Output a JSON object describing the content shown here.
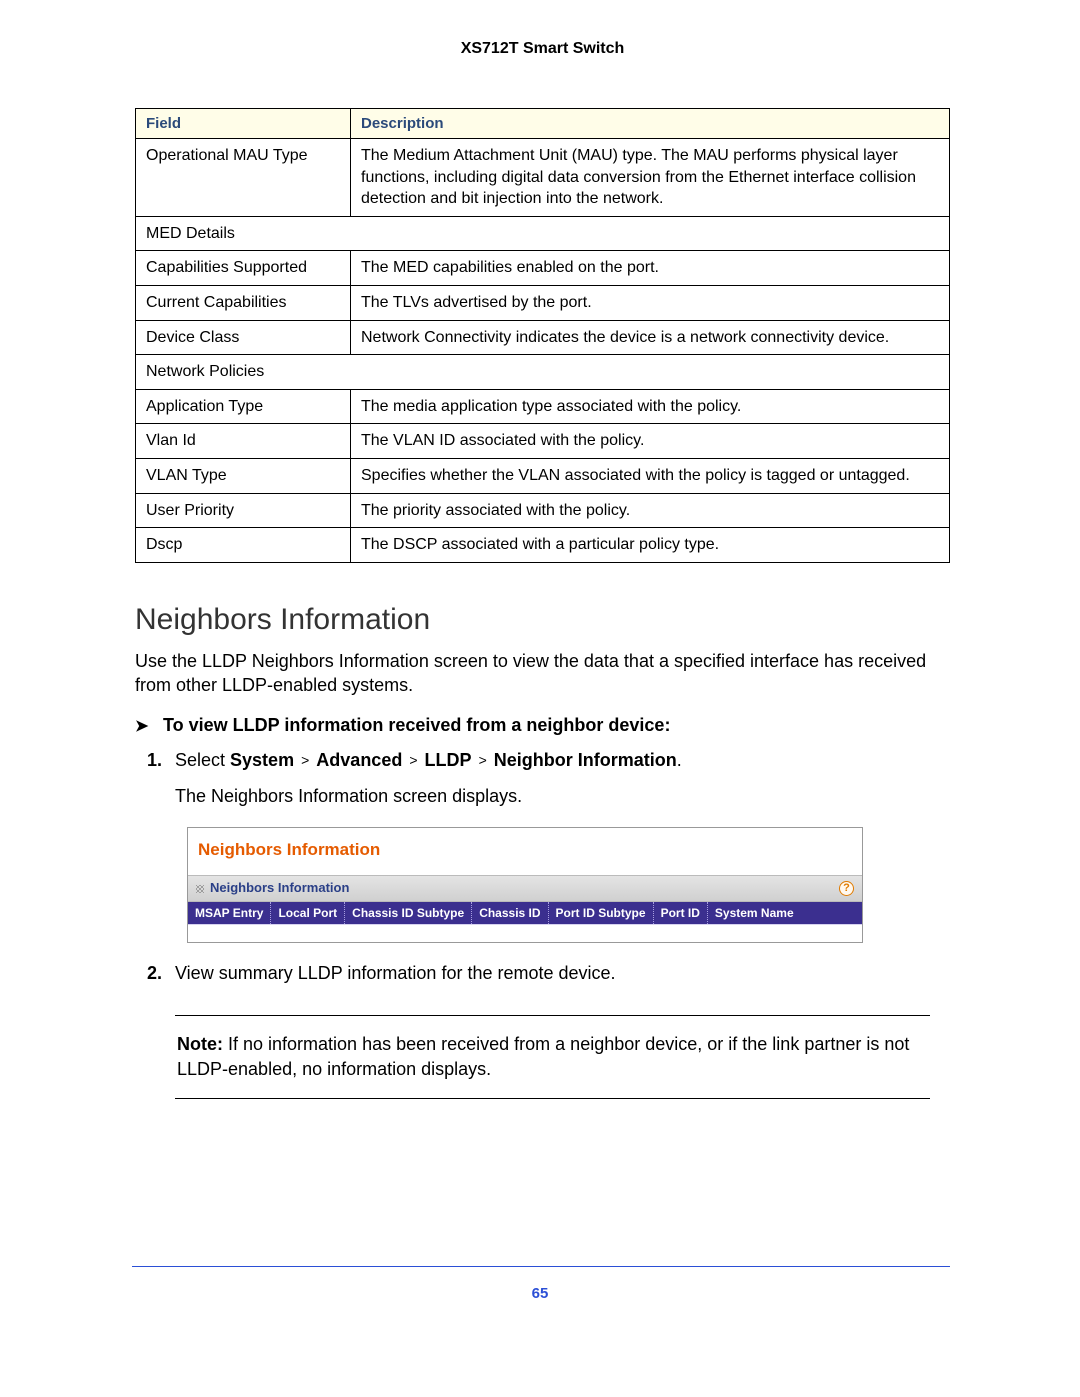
{
  "header": {
    "product": "XS712T Smart Switch"
  },
  "table": {
    "headers": {
      "field": "Field",
      "desc": "Description"
    },
    "rows": [
      {
        "type": "pair",
        "field": "Operational MAU Type",
        "desc": "The Medium Attachment Unit (MAU) type. The MAU performs physical layer functions, including digital data conversion from the Ethernet interface collision detection and bit injection into the network."
      },
      {
        "type": "span",
        "field": "MED Details"
      },
      {
        "type": "pair",
        "field": "Capabilities Supported",
        "desc": "The MED capabilities enabled on the port."
      },
      {
        "type": "pair",
        "field": "Current Capabilities",
        "desc": "The TLVs advertised by the port."
      },
      {
        "type": "pair",
        "field": "Device Class",
        "desc": "Network Connectivity indicates the device is a network connectivity device."
      },
      {
        "type": "span",
        "field": "Network Policies"
      },
      {
        "type": "pair",
        "field": "Application Type",
        "desc": "The media application type associated with the policy."
      },
      {
        "type": "pair",
        "field": "Vlan Id",
        "desc": "The VLAN ID associated with the policy."
      },
      {
        "type": "pair",
        "field": "VLAN Type",
        "desc": "Specifies whether the VLAN associated with the policy is tagged or untagged."
      },
      {
        "type": "pair",
        "field": "User Priority",
        "desc": "The priority associated with the policy."
      },
      {
        "type": "pair",
        "field": "Dscp",
        "desc": "The DSCP associated with a particular policy type."
      }
    ]
  },
  "section": {
    "heading": "Neighbors Information",
    "intro": "Use the LLDP Neighbors Information screen to view the data that a specified interface has received from other LLDP-enabled systems.",
    "procedure_title": "To view LLDP information received from a neighbor device:",
    "step1_prefix": "Select ",
    "nav": {
      "p1": "System",
      "p2": "Advanced",
      "p3": "LLDP",
      "p4": "Neighbor Information",
      "sep": ">"
    },
    "nav_suffix": ".",
    "step1_sub": "The Neighbors Information screen displays.",
    "step2": "View summary LLDP information for the remote device."
  },
  "ui": {
    "title": "Neighbors Information",
    "subtitle": "Neighbors Information",
    "help": "?",
    "cols": [
      "MSAP Entry",
      "Local Port",
      "Chassis ID Subtype",
      "Chassis ID",
      "Port ID Subtype",
      "Port ID",
      "System Name"
    ]
  },
  "note": {
    "label": "Note:",
    "text": " If no information has been received from a neighbor device, or if the link partner is not LLDP-enabled, no information displays."
  },
  "page_number": "65",
  "step_numbers": {
    "s1": "1.",
    "s2": "2."
  }
}
